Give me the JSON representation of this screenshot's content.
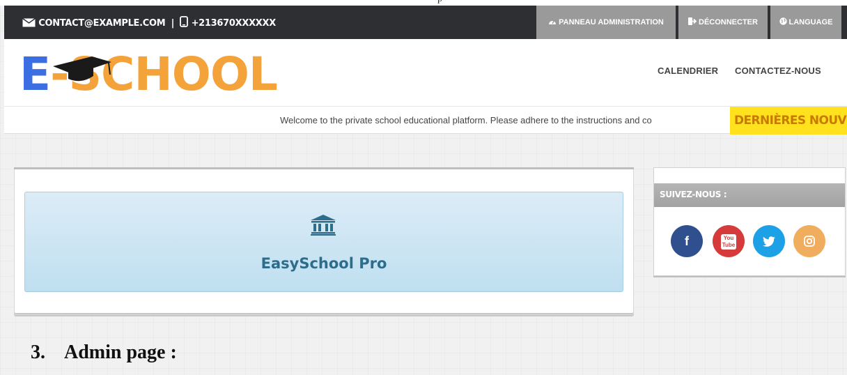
{
  "top_caption": "p",
  "topbar": {
    "email": "CONTACT@EXAMPLE.COM",
    "separator": "|",
    "phone": "+213670XXXXXX",
    "buttons": [
      {
        "label": "PANNEAU ADMINISTRATION",
        "icon": "dashboard-icon"
      },
      {
        "label": "DÉCONNECTER",
        "icon": "sign-out-icon"
      },
      {
        "label": "LANGUAGE",
        "icon": "globe-icon"
      }
    ]
  },
  "header": {
    "logo": {
      "e": "E",
      "dash": "-",
      "school": "SCHOOL"
    },
    "nav": [
      "CALENDRIER",
      "CONTACTEZ-NOUS"
    ]
  },
  "ticker": {
    "text": "Welcome to the private school educational platform. Please adhere to the instructions and co",
    "label": "DERNIÈRES NOUVELLE"
  },
  "main": {
    "app_name": "EasySchool Pro",
    "app_icon": "bank-icon"
  },
  "social": {
    "title": "SUIVEZ-NOUS :",
    "links": [
      {
        "name": "facebook",
        "glyph": "f",
        "color": "#2f4f8f"
      },
      {
        "name": "youtube",
        "glyph": "You Tube",
        "color": "#d63b3b"
      },
      {
        "name": "twitter",
        "glyph": "t",
        "color": "#1da1e6"
      },
      {
        "name": "instagram",
        "glyph": "◎",
        "color": "#f0ad5e"
      }
    ]
  },
  "caption": {
    "number": "3.",
    "text": "Admin page :"
  },
  "colors": {
    "topbar": "#2d2f33",
    "topbar_button": "#9a9a9a",
    "logo_blue": "#3b6ee3",
    "logo_orange": "#f3a33a",
    "ticker_label_bg": "#ffe21d",
    "app_tile_text": "#2d6d8c"
  }
}
